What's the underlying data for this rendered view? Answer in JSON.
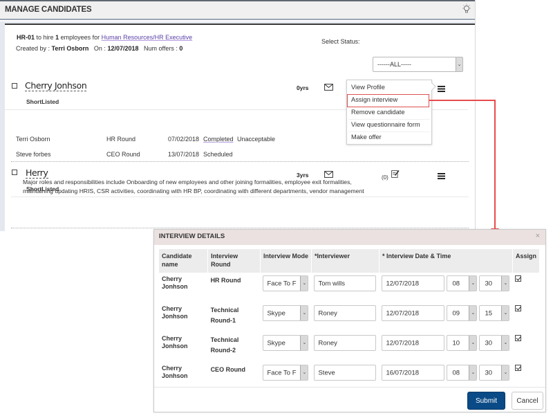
{
  "header": {
    "title": "MANAGE CANDIDATES",
    "icon": "lightbulb-icon"
  },
  "requisition": {
    "id": "HR-01",
    "to_hire_prefix": "to hire",
    "count": "1",
    "employees_for": "employees for",
    "position_link": "Human Resources/HR Executive",
    "created_by_label": "Created by :",
    "created_by": "Terri Osborn",
    "on_label": "On :",
    "on_date": "12/07/2018",
    "num_offers_label": "Num offers :",
    "num_offers": "0"
  },
  "filter": {
    "label": "Select Status:",
    "value": "------ALL-----"
  },
  "candidates": [
    {
      "name": "Cherry Jonhson",
      "status": "ShortListed",
      "experience": "0yrs",
      "rounds": [
        {
          "interviewer": "Terri Osborn",
          "round": "HR Round",
          "date": "07/02/2018",
          "state": "Completed",
          "result": "Unacceptable"
        },
        {
          "interviewer": "Steve forbes",
          "round": "CEO Round",
          "date": "13/07/2018",
          "state": "Scheduled",
          "result": ""
        }
      ]
    },
    {
      "name": "Herry",
      "status": "ShortListed",
      "experience": "3yrs",
      "notes_count": "(0)",
      "description": "Major roles and responsibilities include Onboarding of new employees and other joining formalities, employee exit formalities, maintaining updating HRIS, CSR activities, coordinating with HR BP, coordinating with different departments, vendor management"
    }
  ],
  "action_menu": {
    "items": [
      "View Profile",
      "Assign interview",
      "Remove candidate",
      "View questionnaire form",
      "Make offer"
    ],
    "highlighted": "Assign interview"
  },
  "accent_colors": {
    "annotation": "#e84b4b",
    "submit": "#0a4a86",
    "link": "#5b3fa8"
  },
  "modal": {
    "title": "INTERVIEW DETAILS",
    "close": "×",
    "columns": [
      "Candidate name",
      "Interview Round",
      "Interview Mode",
      "*Interviewer",
      "* Interview Date & Time",
      "Assign"
    ],
    "rows": [
      {
        "candidate": "Cherry Jonhson",
        "round": "HR Round",
        "mode": "Face To F",
        "interviewer": "Tom wills",
        "date": "12/07/2018",
        "hour": "08",
        "minute": "30",
        "assign": true
      },
      {
        "candidate": "Cherry Jonhson",
        "round": "Technical Round-1",
        "mode": "Skype",
        "interviewer": "Roney",
        "date": "12/07/2018",
        "hour": "09",
        "minute": "15",
        "assign": true
      },
      {
        "candidate": "Cherry Jonhson",
        "round": "Technical Round-2",
        "mode": "Skype",
        "interviewer": "Roney",
        "date": "12/07/2018",
        "hour": "10",
        "minute": "30",
        "assign": true
      },
      {
        "candidate": "Cherry Jonhson",
        "round": "CEO Round",
        "mode": "Face To F",
        "interviewer": "Steve",
        "date": "16/07/2018",
        "hour": "08",
        "minute": "30",
        "assign": true
      }
    ],
    "submit_label": "Submit",
    "cancel_label": "Cancel"
  }
}
